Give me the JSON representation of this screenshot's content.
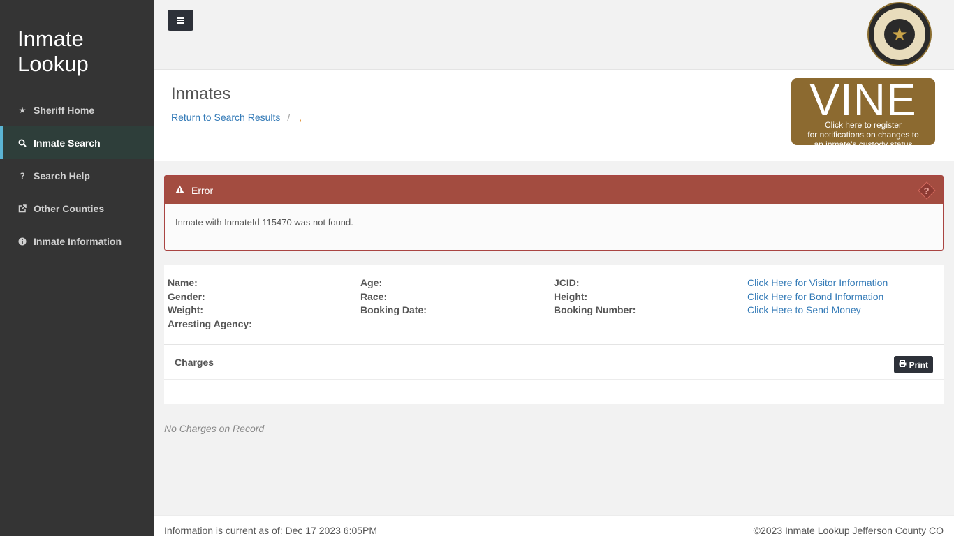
{
  "sidebar": {
    "brand": "Inmate Lookup",
    "items": [
      {
        "label": "Sheriff Home",
        "icon": "star-icon"
      },
      {
        "label": "Inmate Search",
        "icon": "search-icon",
        "active": true
      },
      {
        "label": "Search Help",
        "icon": "question-icon"
      },
      {
        "label": "Other Counties",
        "icon": "external-link-icon"
      },
      {
        "label": "Inmate Information",
        "icon": "info-circle-icon"
      }
    ]
  },
  "header": {
    "menu_icon": "hamburger-icon",
    "seal_icon": "sheriff-seal-icon"
  },
  "page": {
    "title": "Inmates",
    "breadcrumb_link": "Return to Search Results",
    "breadcrumb_sep": "/",
    "breadcrumb_current": ","
  },
  "vine": {
    "title": "VINE",
    "line1": "Click here to register",
    "line2": "for notifications on changes to",
    "line3": "an inmate's custody status"
  },
  "error": {
    "title": "Error",
    "message": "Inmate with InmateId 115470 was not found.",
    "help_icon": "question-diamond-icon",
    "color": "#a34c40"
  },
  "info": {
    "col1": [
      "Name:",
      "Gender:",
      "Weight:",
      "Arresting Agency:"
    ],
    "col2": [
      "Age:",
      "Race:",
      "Booking Date:"
    ],
    "col3": [
      "JCID:",
      "Height:",
      "Booking Number:"
    ],
    "links": [
      "Click Here for Visitor Information",
      "Click Here for Bond Information",
      "Click Here to Send Money"
    ]
  },
  "charges": {
    "title": "Charges",
    "print_label": "Print",
    "empty_text": "No Charges on Record"
  },
  "footer": {
    "current_as_of": "Information is current as of: Dec 17 2023 6:05PM",
    "copyright": "©2023 Inmate Lookup Jefferson County CO"
  }
}
